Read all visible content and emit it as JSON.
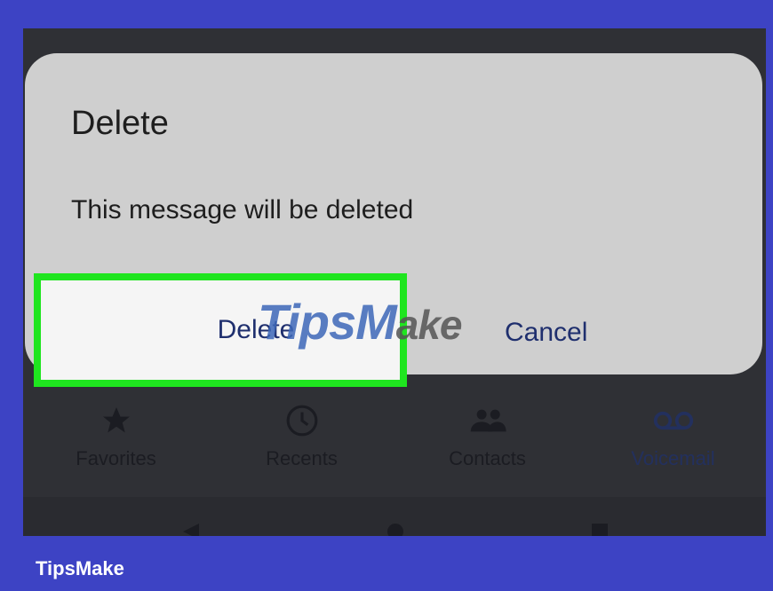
{
  "dialog": {
    "title": "Delete",
    "message": "This message will be deleted",
    "delete_label": "Delete",
    "cancel_label": "Cancel"
  },
  "watermark": {
    "part1": "TipsM",
    "part2": "ake"
  },
  "bottom_nav": {
    "items": [
      {
        "label": "Favorites",
        "icon": "star-icon"
      },
      {
        "label": "Recents",
        "icon": "clock-icon"
      },
      {
        "label": "Contacts",
        "icon": "contacts-icon"
      },
      {
        "label": "Voicemail",
        "icon": "voicemail-icon"
      }
    ]
  },
  "footer": {
    "brand": "TipsMake"
  },
  "colors": {
    "frame": "#3d43c4",
    "highlight": "#1fe51f",
    "dialog_bg": "#cfcfcf",
    "button_text": "#1f2f6e"
  }
}
